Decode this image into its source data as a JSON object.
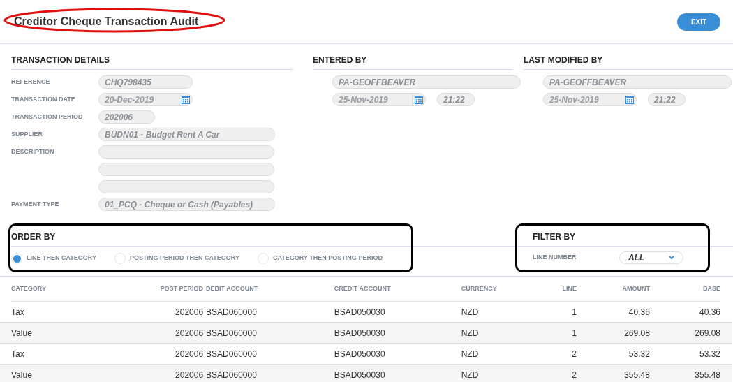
{
  "title": "Creditor Cheque Transaction Audit",
  "exit_button": "EXIT",
  "transaction_details": {
    "heading": "TRANSACTION DETAILS",
    "fields": [
      {
        "label": "REFERENCE",
        "value": "CHQ798435",
        "kind": "short"
      },
      {
        "label": "TRANSACTION DATE",
        "value": "20-Dec-2019",
        "kind": "date"
      },
      {
        "label": "TRANSACTION PERIOD",
        "value": "202006",
        "kind": "tiny"
      },
      {
        "label": "SUPPLIER",
        "value": "BUDN01 - Budget Rent A Car",
        "kind": "wide"
      },
      {
        "label": "DESCRIPTION",
        "kind": "multiline"
      },
      {
        "label": "PAYMENT TYPE",
        "value": "01_PCQ - Cheque or Cash (Payables)",
        "kind": "wide"
      }
    ]
  },
  "entered_by": {
    "heading": "ENTERED BY",
    "user": "PA-GEOFFBEAVER",
    "date": "25-Nov-2019",
    "time": "21:22"
  },
  "last_modified_by": {
    "heading": "LAST MODIFIED BY",
    "user": "PA-GEOFFBEAVER",
    "date": "25-Nov-2019",
    "time": "21:22"
  },
  "order_by": {
    "heading": "ORDER BY",
    "options": [
      {
        "label": "LINE THEN CATEGORY",
        "selected": true
      },
      {
        "label": "POSTING PERIOD THEN CATEGORY",
        "selected": false
      },
      {
        "label": "CATEGORY THEN POSTING PERIOD",
        "selected": false
      }
    ]
  },
  "filter_by": {
    "heading": "FILTER BY",
    "label": "LINE NUMBER",
    "value": "ALL"
  },
  "table": {
    "columns": [
      "CATEGORY",
      "POST PERIOD",
      "DEBIT ACCOUNT",
      "CREDIT ACCOUNT",
      "CURRENCY",
      "LINE",
      "AMOUNT",
      "BASE"
    ],
    "rows": [
      [
        "Tax",
        "202006",
        "BSAD060000",
        "BSAD050030",
        "NZD",
        "1",
        "40.36",
        "40.36"
      ],
      [
        "Value",
        "202006",
        "BSAD060000",
        "BSAD050030",
        "NZD",
        "1",
        "269.08",
        "269.08"
      ],
      [
        "Tax",
        "202006",
        "BSAD060000",
        "BSAD050030",
        "NZD",
        "2",
        "53.32",
        "53.32"
      ],
      [
        "Value",
        "202006",
        "BSAD060000",
        "BSAD050030",
        "NZD",
        "2",
        "355.48",
        "355.48"
      ]
    ]
  }
}
